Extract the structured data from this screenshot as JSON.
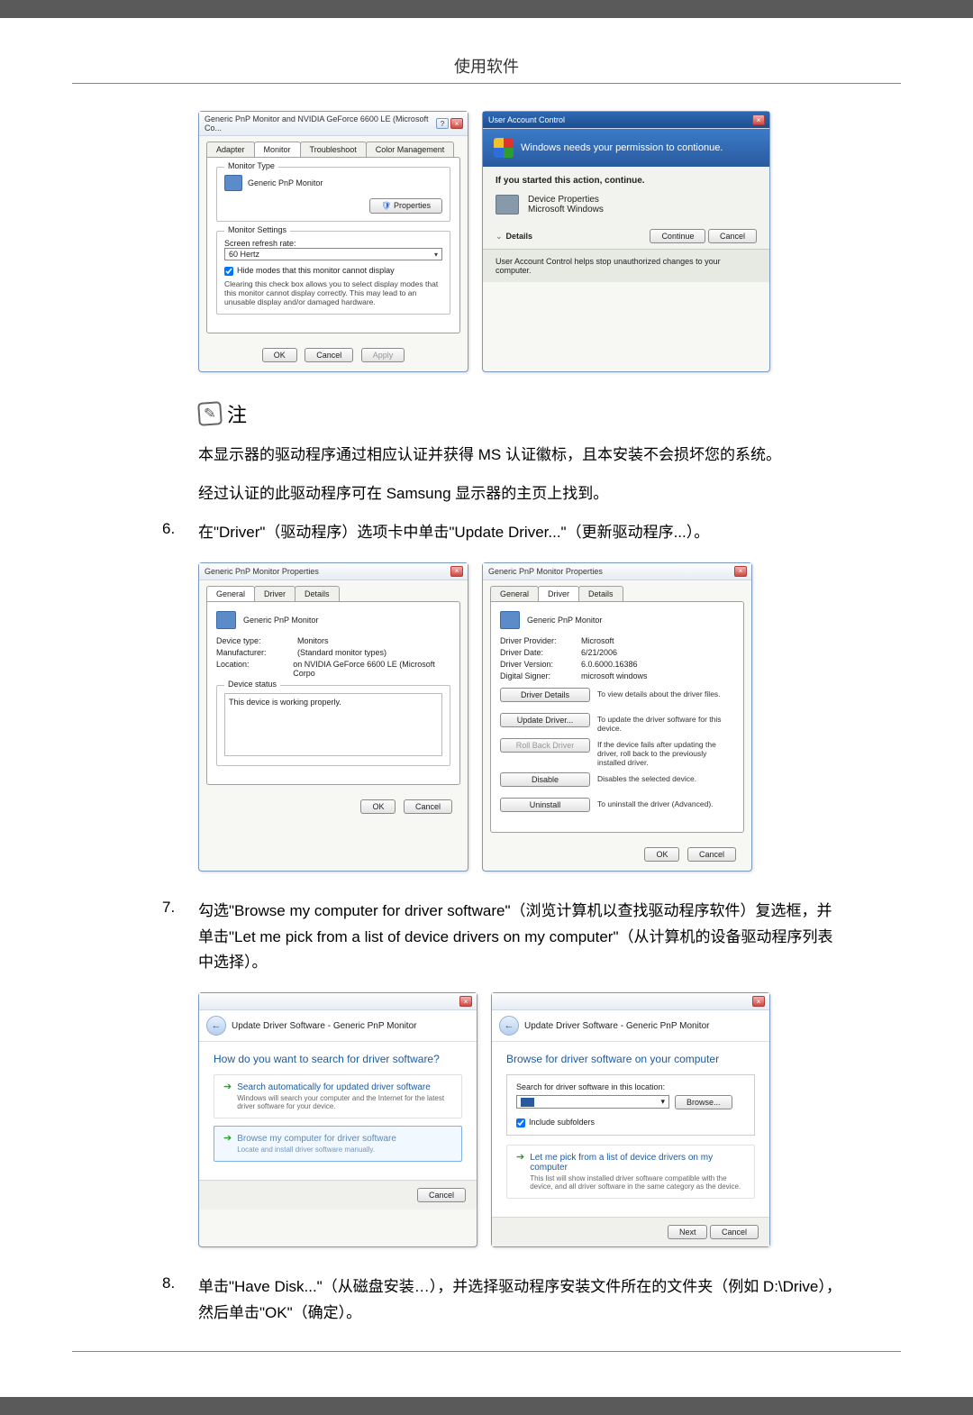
{
  "page_header": "使用软件",
  "dialog1": {
    "title": "Generic PnP Monitor and NVIDIA GeForce 6600 LE (Microsoft Co...",
    "tabs": [
      "Adapter",
      "Monitor",
      "Troubleshoot",
      "Color Management"
    ],
    "monitor_type_legend": "Monitor Type",
    "monitor_name": "Generic PnP Monitor",
    "properties_btn": "Properties",
    "settings_legend": "Monitor Settings",
    "refresh_label": "Screen refresh rate:",
    "refresh_value": "60 Hertz",
    "hide_check": "Hide modes that this monitor cannot display",
    "hide_desc": "Clearing this check box allows you to select display modes that this monitor cannot display correctly. This may lead to an unusable display and/or damaged hardware.",
    "ok": "OK",
    "cancel": "Cancel",
    "apply": "Apply"
  },
  "uac": {
    "title_bar": "User Account Control",
    "blue_text": "Windows needs your permission to contionue.",
    "if_started": "If you started this action, continue.",
    "dev_props": "Device Properties",
    "ms_windows": "Microsoft Windows",
    "details": "Details",
    "continue": "Continue",
    "cancel": "Cancel",
    "footer": "User Account Control helps stop unauthorized changes to your computer."
  },
  "note_label": "注",
  "para1": "本显示器的驱动程序通过相应认证并获得 MS 认证徽标，且本安装不会损坏您的系统。",
  "para2": "经过认证的此驱动程序可在 Samsung 显示器的主页上找到。",
  "step6_num": "6.",
  "step6": "在\"Driver\"（驱动程序）选项卡中单击\"Update Driver...\"（更新驱动程序...）。",
  "props1": {
    "title": "Generic PnP Monitor Properties",
    "tabs": [
      "General",
      "Driver",
      "Details"
    ],
    "header_name": "Generic PnP Monitor",
    "device_type_l": "Device type:",
    "device_type_v": "Monitors",
    "manufacturer_l": "Manufacturer:",
    "manufacturer_v": "(Standard monitor types)",
    "location_l": "Location:",
    "location_v": "on NVIDIA GeForce 6600 LE (Microsoft Corpo",
    "status_legend": "Device status",
    "status_text": "This device is working properly.",
    "ok": "OK",
    "cancel": "Cancel"
  },
  "props2": {
    "title": "Generic PnP Monitor Properties",
    "tabs": [
      "General",
      "Driver",
      "Details"
    ],
    "header_name": "Generic PnP Monitor",
    "provider_l": "Driver Provider:",
    "provider_v": "Microsoft",
    "date_l": "Driver Date:",
    "date_v": "6/21/2006",
    "version_l": "Driver Version:",
    "version_v": "6.0.6000.16386",
    "signer_l": "Digital Signer:",
    "signer_v": "microsoft windows",
    "btn_details": "Driver Details",
    "btn_details_d": "To view details about the driver files.",
    "btn_update": "Update Driver...",
    "btn_update_d": "To update the driver software for this device.",
    "btn_rollback": "Roll Back Driver",
    "btn_rollback_d": "If the device fails after updating the driver, roll back to the previously installed driver.",
    "btn_disable": "Disable",
    "btn_disable_d": "Disables the selected device.",
    "btn_uninstall": "Uninstall",
    "btn_uninstall_d": "To uninstall the driver (Advanced).",
    "ok": "OK",
    "cancel": "Cancel"
  },
  "step7_num": "7.",
  "step7": "勾选\"Browse my computer for driver software\"（浏览计算机以查找驱动程序软件）复选框，并单击\"Let me pick from a list of device drivers on my computer\"（从计算机的设备驱动程序列表中选择）。",
  "wiz1": {
    "crumb": "Update Driver Software - Generic PnP Monitor",
    "heading": "How do you want to search for driver software?",
    "opt1_title": "Search automatically for updated driver software",
    "opt1_desc": "Windows will search your computer and the Internet for the latest driver software for your device.",
    "opt2_title": "Browse my computer for driver software",
    "opt2_desc": "Locate and install driver software manually.",
    "cancel": "Cancel"
  },
  "wiz2": {
    "crumb": "Update Driver Software - Generic PnP Monitor",
    "heading": "Browse for driver software on your computer",
    "search_lbl": "Search for driver software in this location:",
    "browse": "Browse...",
    "include": "Include subfolders",
    "opt_title": "Let me pick from a list of device drivers on my computer",
    "opt_desc": "This list will show installed driver software compatible with the device, and all driver software in the same category as the device.",
    "next": "Next",
    "cancel": "Cancel"
  },
  "step8_num": "8.",
  "step8": "单击\"Have Disk...\"（从磁盘安装…），并选择驱动程序安装文件所在的文件夹（例如 D:\\Drive），然后单击\"OK\"（确定）。"
}
